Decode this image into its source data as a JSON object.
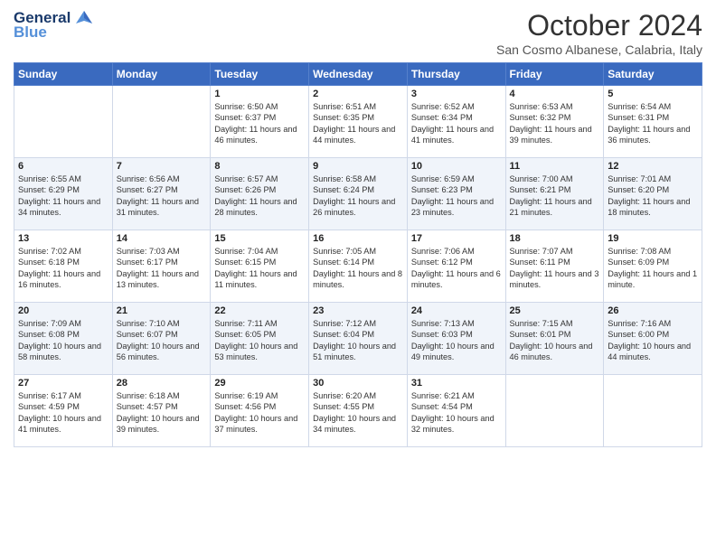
{
  "header": {
    "logo_line1": "General",
    "logo_line2": "Blue",
    "title": "October 2024",
    "subtitle": "San Cosmo Albanese, Calabria, Italy"
  },
  "days_of_week": [
    "Sunday",
    "Monday",
    "Tuesday",
    "Wednesday",
    "Thursday",
    "Friday",
    "Saturday"
  ],
  "weeks": [
    [
      {
        "day": "",
        "content": ""
      },
      {
        "day": "",
        "content": ""
      },
      {
        "day": "1",
        "content": "Sunrise: 6:50 AM\nSunset: 6:37 PM\nDaylight: 11 hours and 46 minutes."
      },
      {
        "day": "2",
        "content": "Sunrise: 6:51 AM\nSunset: 6:35 PM\nDaylight: 11 hours and 44 minutes."
      },
      {
        "day": "3",
        "content": "Sunrise: 6:52 AM\nSunset: 6:34 PM\nDaylight: 11 hours and 41 minutes."
      },
      {
        "day": "4",
        "content": "Sunrise: 6:53 AM\nSunset: 6:32 PM\nDaylight: 11 hours and 39 minutes."
      },
      {
        "day": "5",
        "content": "Sunrise: 6:54 AM\nSunset: 6:31 PM\nDaylight: 11 hours and 36 minutes."
      }
    ],
    [
      {
        "day": "6",
        "content": "Sunrise: 6:55 AM\nSunset: 6:29 PM\nDaylight: 11 hours and 34 minutes."
      },
      {
        "day": "7",
        "content": "Sunrise: 6:56 AM\nSunset: 6:27 PM\nDaylight: 11 hours and 31 minutes."
      },
      {
        "day": "8",
        "content": "Sunrise: 6:57 AM\nSunset: 6:26 PM\nDaylight: 11 hours and 28 minutes."
      },
      {
        "day": "9",
        "content": "Sunrise: 6:58 AM\nSunset: 6:24 PM\nDaylight: 11 hours and 26 minutes."
      },
      {
        "day": "10",
        "content": "Sunrise: 6:59 AM\nSunset: 6:23 PM\nDaylight: 11 hours and 23 minutes."
      },
      {
        "day": "11",
        "content": "Sunrise: 7:00 AM\nSunset: 6:21 PM\nDaylight: 11 hours and 21 minutes."
      },
      {
        "day": "12",
        "content": "Sunrise: 7:01 AM\nSunset: 6:20 PM\nDaylight: 11 hours and 18 minutes."
      }
    ],
    [
      {
        "day": "13",
        "content": "Sunrise: 7:02 AM\nSunset: 6:18 PM\nDaylight: 11 hours and 16 minutes."
      },
      {
        "day": "14",
        "content": "Sunrise: 7:03 AM\nSunset: 6:17 PM\nDaylight: 11 hours and 13 minutes."
      },
      {
        "day": "15",
        "content": "Sunrise: 7:04 AM\nSunset: 6:15 PM\nDaylight: 11 hours and 11 minutes."
      },
      {
        "day": "16",
        "content": "Sunrise: 7:05 AM\nSunset: 6:14 PM\nDaylight: 11 hours and 8 minutes."
      },
      {
        "day": "17",
        "content": "Sunrise: 7:06 AM\nSunset: 6:12 PM\nDaylight: 11 hours and 6 minutes."
      },
      {
        "day": "18",
        "content": "Sunrise: 7:07 AM\nSunset: 6:11 PM\nDaylight: 11 hours and 3 minutes."
      },
      {
        "day": "19",
        "content": "Sunrise: 7:08 AM\nSunset: 6:09 PM\nDaylight: 11 hours and 1 minute."
      }
    ],
    [
      {
        "day": "20",
        "content": "Sunrise: 7:09 AM\nSunset: 6:08 PM\nDaylight: 10 hours and 58 minutes."
      },
      {
        "day": "21",
        "content": "Sunrise: 7:10 AM\nSunset: 6:07 PM\nDaylight: 10 hours and 56 minutes."
      },
      {
        "day": "22",
        "content": "Sunrise: 7:11 AM\nSunset: 6:05 PM\nDaylight: 10 hours and 53 minutes."
      },
      {
        "day": "23",
        "content": "Sunrise: 7:12 AM\nSunset: 6:04 PM\nDaylight: 10 hours and 51 minutes."
      },
      {
        "day": "24",
        "content": "Sunrise: 7:13 AM\nSunset: 6:03 PM\nDaylight: 10 hours and 49 minutes."
      },
      {
        "day": "25",
        "content": "Sunrise: 7:15 AM\nSunset: 6:01 PM\nDaylight: 10 hours and 46 minutes."
      },
      {
        "day": "26",
        "content": "Sunrise: 7:16 AM\nSunset: 6:00 PM\nDaylight: 10 hours and 44 minutes."
      }
    ],
    [
      {
        "day": "27",
        "content": "Sunrise: 6:17 AM\nSunset: 4:59 PM\nDaylight: 10 hours and 41 minutes."
      },
      {
        "day": "28",
        "content": "Sunrise: 6:18 AM\nSunset: 4:57 PM\nDaylight: 10 hours and 39 minutes."
      },
      {
        "day": "29",
        "content": "Sunrise: 6:19 AM\nSunset: 4:56 PM\nDaylight: 10 hours and 37 minutes."
      },
      {
        "day": "30",
        "content": "Sunrise: 6:20 AM\nSunset: 4:55 PM\nDaylight: 10 hours and 34 minutes."
      },
      {
        "day": "31",
        "content": "Sunrise: 6:21 AM\nSunset: 4:54 PM\nDaylight: 10 hours and 32 minutes."
      },
      {
        "day": "",
        "content": ""
      },
      {
        "day": "",
        "content": ""
      }
    ]
  ]
}
